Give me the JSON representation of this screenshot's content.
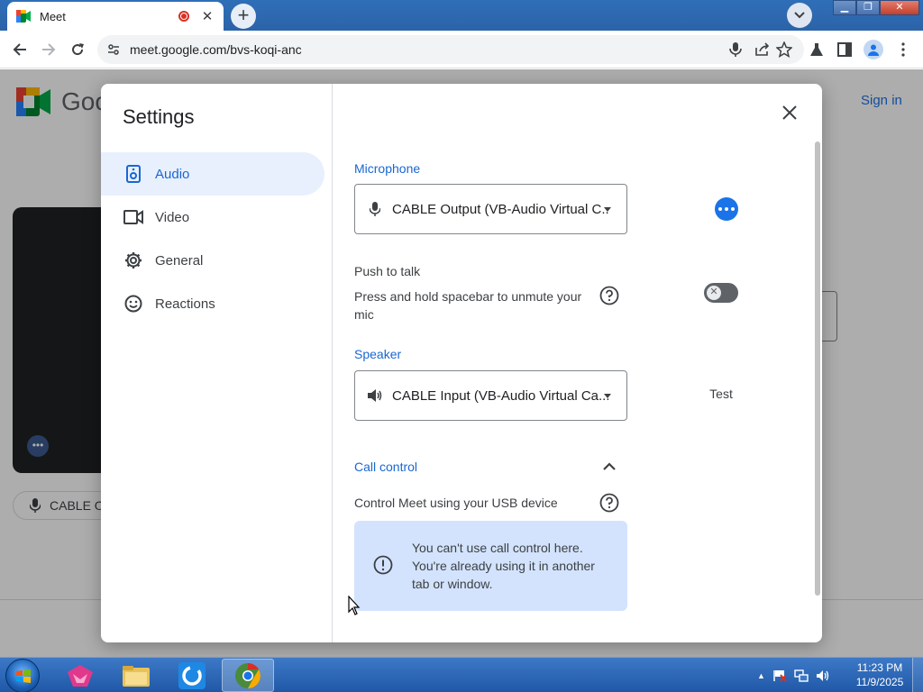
{
  "browser": {
    "tab_title": "Meet",
    "url": "meet.google.com/bvs-koqi-anc"
  },
  "page": {
    "logo_text": "Goo",
    "sign_in": "Sign in",
    "mic_pill": "CABLE O"
  },
  "settings": {
    "title": "Settings",
    "nav": [
      {
        "label": "Audio",
        "icon": "speaker-icon",
        "active": true
      },
      {
        "label": "Video",
        "icon": "videocam-icon",
        "active": false
      },
      {
        "label": "General",
        "icon": "gear-icon",
        "active": false
      },
      {
        "label": "Reactions",
        "icon": "smiley-icon",
        "active": false
      }
    ],
    "microphone": {
      "heading": "Microphone",
      "selected": "CABLE Output (VB-Audio Virtual C..."
    },
    "push_to_talk": {
      "label": "Push to talk",
      "description": "Press and hold spacebar to unmute your mic",
      "enabled": false
    },
    "speaker": {
      "heading": "Speaker",
      "selected": "CABLE Input (VB-Audio Virtual Ca...",
      "test_label": "Test"
    },
    "call_control": {
      "heading": "Call control",
      "description": "Control Meet using your USB device",
      "info": "You can't use call control here. You're already using it in another tab or window."
    }
  },
  "taskbar": {
    "time": "11:23 PM",
    "date": "11/9/2025"
  },
  "colors": {
    "accent": "#1967d2",
    "active_nav_bg": "#e8f0fe",
    "info_bg": "#d3e3fd",
    "taskbar": "#2a64b0"
  }
}
